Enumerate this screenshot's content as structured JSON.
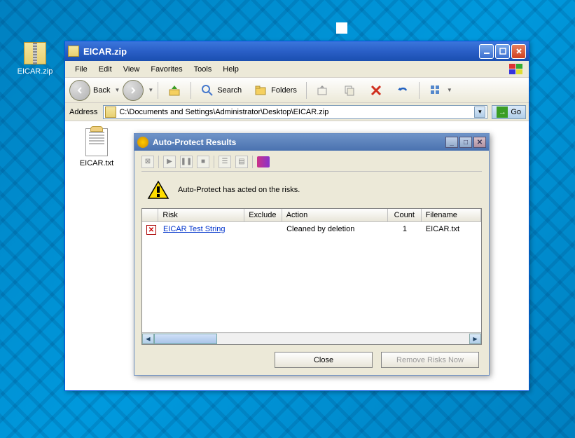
{
  "desktop": {
    "icon_label": "EICAR.zip"
  },
  "explorer": {
    "title": "EICAR.zip",
    "menus": [
      "File",
      "Edit",
      "View",
      "Favorites",
      "Tools",
      "Help"
    ],
    "toolbar": {
      "back": "Back",
      "search": "Search",
      "folders": "Folders"
    },
    "address": {
      "label": "Address",
      "path": "C:\\Documents and Settings\\Administrator\\Desktop\\EICAR.zip",
      "go": "Go"
    },
    "file": {
      "name": "EICAR.txt"
    }
  },
  "dialog": {
    "title": "Auto-Protect Results",
    "message": "Auto-Protect has acted on the risks.",
    "columns": [
      "",
      "Risk",
      "Exclude",
      "Action",
      "Count",
      "Filename"
    ],
    "rows": [
      {
        "risk": "EICAR Test String",
        "exclude": "",
        "action": "Cleaned by deletion",
        "count": "1",
        "filename": "EICAR.txt"
      }
    ],
    "buttons": {
      "close": "Close",
      "remove": "Remove Risks Now"
    }
  }
}
